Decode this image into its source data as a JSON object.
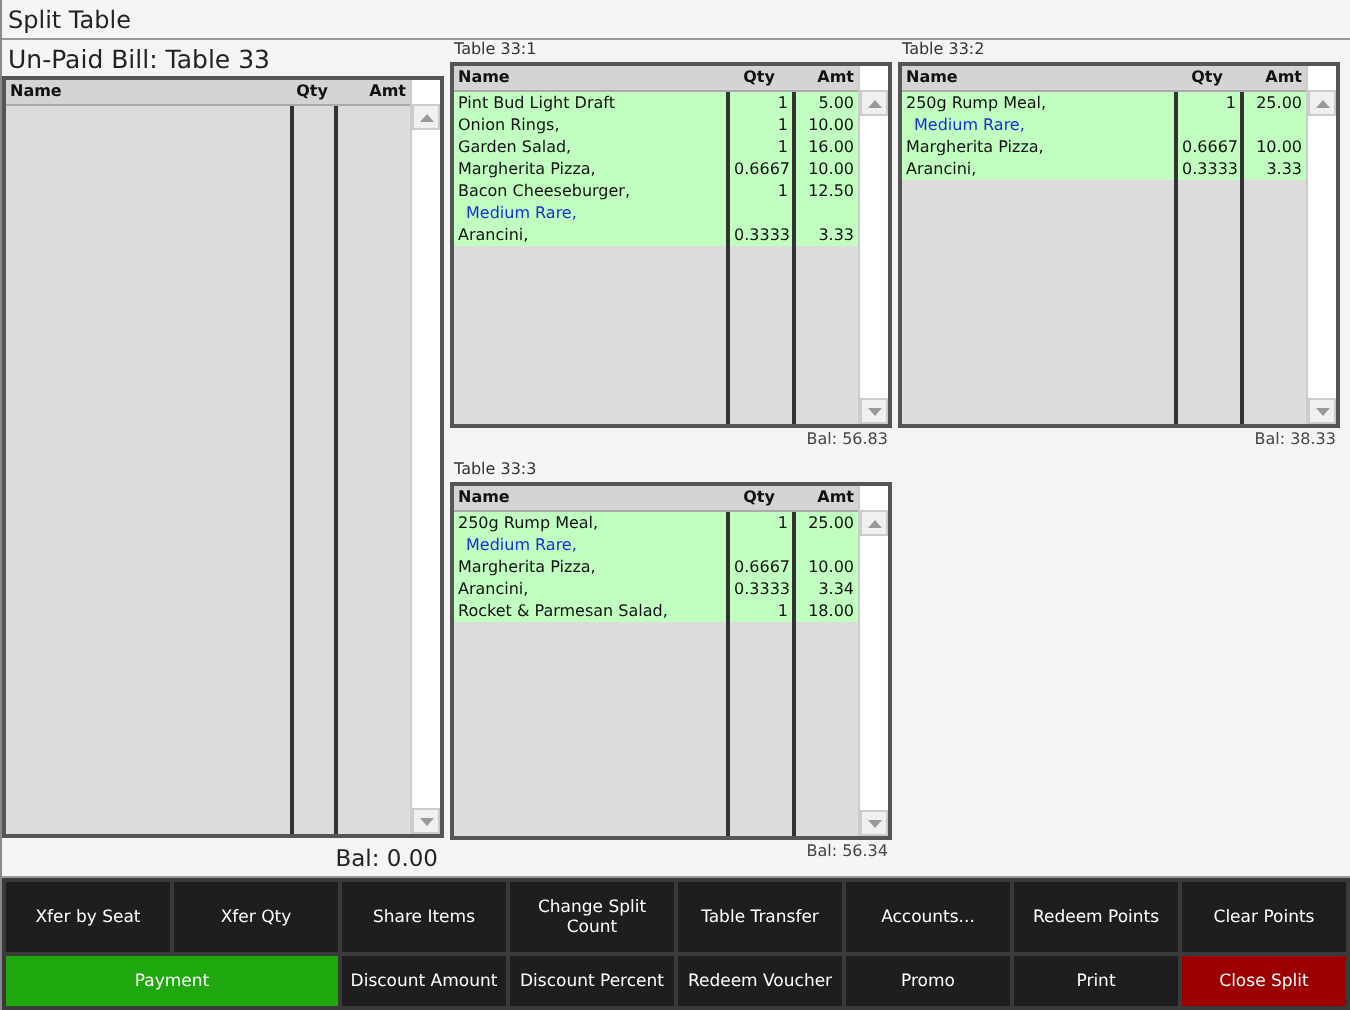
{
  "window": {
    "title": "Split Table"
  },
  "unpaid": {
    "title": "Un-Paid Bill: Table 33",
    "columns": [
      "Name",
      "Qty",
      "Amt"
    ],
    "balance": "Bal: 0.00"
  },
  "splits": [
    {
      "title": "Table 33:1",
      "columns": [
        "Name",
        "Qty",
        "Amt"
      ],
      "rows": [
        {
          "kind": "item",
          "name": "Pint Bud Light Draft",
          "qty": "1",
          "amt": "5.00"
        },
        {
          "kind": "item",
          "name": "Onion Rings,",
          "qty": "1",
          "amt": "10.00"
        },
        {
          "kind": "item",
          "name": "Garden Salad,",
          "qty": "1",
          "amt": "16.00"
        },
        {
          "kind": "item",
          "name": "Margherita Pizza,",
          "qty": "0.6667",
          "amt": "10.00"
        },
        {
          "kind": "item",
          "name": "Bacon Cheeseburger,",
          "qty": "1",
          "amt": "12.50"
        },
        {
          "kind": "modifier",
          "name": "Medium Rare,"
        },
        {
          "kind": "item",
          "name": "Arancini,",
          "qty": "0.3333",
          "amt": "3.33"
        }
      ],
      "balance": "Bal: 56.83"
    },
    {
      "title": "Table 33:2",
      "columns": [
        "Name",
        "Qty",
        "Amt"
      ],
      "rows": [
        {
          "kind": "item",
          "name": "250g Rump Meal,",
          "qty": "1",
          "amt": "25.00"
        },
        {
          "kind": "modifier",
          "name": "Medium Rare,"
        },
        {
          "kind": "item",
          "name": "Margherita Pizza,",
          "qty": "0.6667",
          "amt": "10.00"
        },
        {
          "kind": "item",
          "name": "Arancini,",
          "qty": "0.3333",
          "amt": "3.33"
        }
      ],
      "balance": "Bal: 38.33"
    },
    {
      "title": "Table 33:3",
      "columns": [
        "Name",
        "Qty",
        "Amt"
      ],
      "rows": [
        {
          "kind": "item",
          "name": "250g Rump Meal,",
          "qty": "1",
          "amt": "25.00"
        },
        {
          "kind": "modifier",
          "name": "Medium Rare,"
        },
        {
          "kind": "item",
          "name": "Margherita Pizza,",
          "qty": "0.6667",
          "amt": "10.00"
        },
        {
          "kind": "item",
          "name": "Arancini,",
          "qty": "0.3333",
          "amt": "3.34"
        },
        {
          "kind": "item",
          "name": "Rocket & Parmesan Salad,",
          "qty": "1",
          "amt": "18.00"
        }
      ],
      "balance": "Bal: 56.34"
    }
  ],
  "buttons": [
    {
      "label": "Xfer by Seat",
      "kind": "normal"
    },
    {
      "label": "Xfer Qty",
      "kind": "normal"
    },
    {
      "label": "Share Items",
      "kind": "normal"
    },
    {
      "label": "Change Split Count",
      "kind": "normal"
    },
    {
      "label": "Table Transfer",
      "kind": "normal"
    },
    {
      "label": "Accounts...",
      "kind": "normal"
    },
    {
      "label": "Redeem Points",
      "kind": "normal"
    },
    {
      "label": "Clear Points",
      "kind": "normal"
    },
    {
      "label": "Payment",
      "kind": "go"
    },
    {
      "label": "Discount Amount",
      "kind": "normal"
    },
    {
      "label": "Discount Percent",
      "kind": "normal"
    },
    {
      "label": "Redeem Voucher",
      "kind": "normal"
    },
    {
      "label": "Promo",
      "kind": "normal"
    },
    {
      "label": "Print",
      "kind": "normal"
    },
    {
      "label": "Close Split",
      "kind": "danger"
    }
  ]
}
